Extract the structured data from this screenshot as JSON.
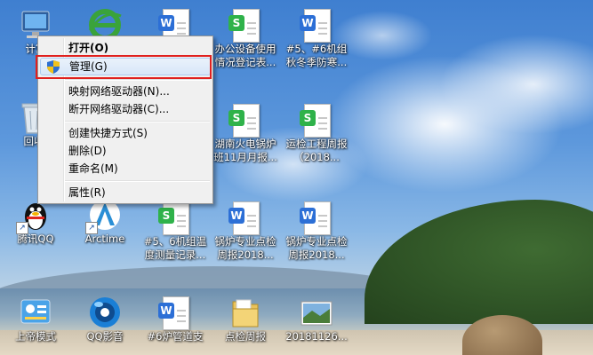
{
  "desktop_icons": [
    {
      "id": "computer",
      "label": "计算",
      "type": "computer"
    },
    {
      "id": "ie",
      "label": "",
      "type": "ie"
    },
    {
      "id": "doc-w-top1",
      "label": "",
      "type": "w"
    },
    {
      "id": "doc-s-top",
      "label": "办公设备使用情况登记表...",
      "type": "s"
    },
    {
      "id": "doc-w-top2",
      "label": "#5、#6机组秋冬季防寒...",
      "type": "w"
    },
    {
      "id": "recycle",
      "label": "回收",
      "type": "recycle"
    },
    {
      "id": "doc-s-hunan",
      "label": "湖南火电锅炉班11月月报...",
      "type": "s"
    },
    {
      "id": "doc-s-yunjian",
      "label": "运检工程周报（2018...",
      "type": "s"
    },
    {
      "id": "qq",
      "label": "腾讯QQ",
      "type": "qq"
    },
    {
      "id": "arctime",
      "label": "Arctime",
      "type": "arctime"
    },
    {
      "id": "doc-s-temp",
      "label": "#5、6机组温度测量记录...",
      "type": "s"
    },
    {
      "id": "doc-w-guolu1",
      "label": "锅炉专业点检周报2018...",
      "type": "w"
    },
    {
      "id": "doc-w-guolu2",
      "label": "锅炉专业点检周报2018...",
      "type": "w"
    },
    {
      "id": "app-bottom1",
      "label": "上帝模式",
      "type": "settings"
    },
    {
      "id": "qqplayer",
      "label": "QQ影音",
      "type": "qqplayer"
    },
    {
      "id": "doc-w-pipe",
      "label": "#6炉管道支",
      "type": "w"
    },
    {
      "id": "folder",
      "label": "点检周报",
      "type": "folder"
    },
    {
      "id": "image",
      "label": "20181126...",
      "type": "image"
    }
  ],
  "context_menu": {
    "items": [
      {
        "label": "打开(O)",
        "bold": true
      },
      {
        "label": "管理(G)",
        "highlighted": true,
        "icon": "shield-icon"
      },
      {
        "separator": true
      },
      {
        "label": "映射网络驱动器(N)..."
      },
      {
        "label": "断开网络驱动器(C)..."
      },
      {
        "separator": true
      },
      {
        "label": "创建快捷方式(S)"
      },
      {
        "label": "删除(D)"
      },
      {
        "label": "重命名(M)"
      },
      {
        "separator": true
      },
      {
        "label": "属性(R)"
      }
    ]
  },
  "colors": {
    "highlight_border": "#e0201e",
    "menu_bg": "#f0f0f0",
    "wps_green": "#2fb24a",
    "wps_blue": "#2c6fd6"
  }
}
